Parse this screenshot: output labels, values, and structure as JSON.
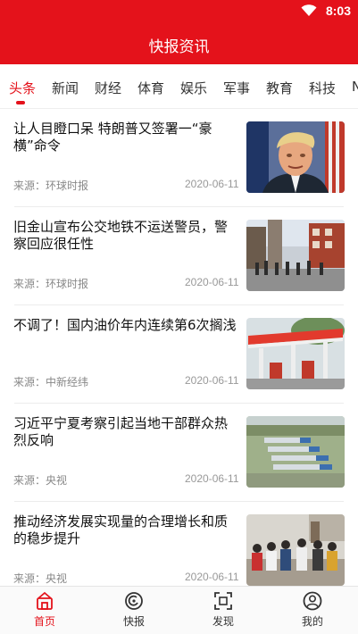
{
  "status_bar": {
    "time": "8:03",
    "wifi_icon": "wifi-icon"
  },
  "app": {
    "title": "快报资讯",
    "brand_color": "#e4121b"
  },
  "tabs": [
    {
      "label": "头条",
      "active": true
    },
    {
      "label": "新闻",
      "active": false
    },
    {
      "label": "财经",
      "active": false
    },
    {
      "label": "体育",
      "active": false
    },
    {
      "label": "娱乐",
      "active": false
    },
    {
      "label": "军事",
      "active": false
    },
    {
      "label": "教育",
      "active": false
    },
    {
      "label": "科技",
      "active": false
    },
    {
      "label": "N",
      "active": false
    }
  ],
  "news": [
    {
      "title": "让人目瞪口呆 特朗普又签署一“豪横”命令",
      "source": "来源：环球时报",
      "date": "2020-06-11",
      "image": "portrait-photo"
    },
    {
      "title": "旧金山宣布公交地铁不运送警员，警察回应很任性",
      "source": "来源：环球时报",
      "date": "2020-06-11",
      "image": "street-scene-photo"
    },
    {
      "title": "不调了！国内油价年内连续第6次搁浅",
      "source": "来源：中新经纬",
      "date": "2020-06-11",
      "image": "gas-station-photo"
    },
    {
      "title": "习近平宁夏考察引起当地干部群众热烈反响",
      "source": "来源：央视",
      "date": "2020-06-11",
      "image": "aerial-village-photo"
    },
    {
      "title": "推动经济发展实现量的合理增长和质的稳步提升",
      "source": "来源：央视",
      "date": "2020-06-11",
      "image": "crowd-photo"
    }
  ],
  "bottom_nav": [
    {
      "label": "首页",
      "icon": "home-icon",
      "active": true
    },
    {
      "label": "快报",
      "icon": "news-flash-icon",
      "active": false
    },
    {
      "label": "发现",
      "icon": "scan-icon",
      "active": false
    },
    {
      "label": "我的",
      "icon": "profile-icon",
      "active": false
    }
  ]
}
